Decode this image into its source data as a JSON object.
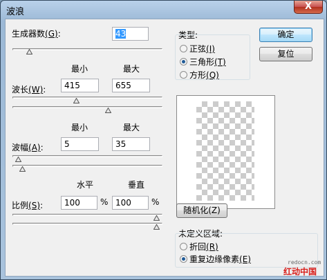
{
  "window": {
    "title": "波浪",
    "close_glyph": "X"
  },
  "generators": {
    "label": "生成器数",
    "hotkey": "(G)",
    "colon": ":",
    "value": "43",
    "slider_value_fraction": 0.08
  },
  "column_headers": {
    "min": "最小",
    "max": "最大",
    "horizontal": "水平",
    "vertical": "垂直"
  },
  "wavelength": {
    "label": "波长",
    "hotkey": "(W)",
    "colon": ":",
    "min": "415",
    "max": "655",
    "min_fraction": 0.42,
    "max_fraction": 0.65
  },
  "amplitude": {
    "label": "波幅",
    "hotkey": "(A)",
    "colon": ":",
    "min": "5",
    "max": "35",
    "min_fraction": 0.0,
    "max_fraction": 0.03
  },
  "scale": {
    "label": "比例",
    "hotkey": "(S)",
    "colon": ":",
    "horizontal": "100",
    "vertical": "100",
    "unit": "%",
    "h_fraction": 1.0,
    "v_fraction": 1.0
  },
  "type_group": {
    "title": "类型:",
    "options": [
      {
        "label": "正弦",
        "hotkey": "(I)",
        "selected": false
      },
      {
        "label": "三角形",
        "hotkey": "(T)",
        "selected": true
      },
      {
        "label": "方形",
        "hotkey": "(Q)",
        "selected": false
      }
    ]
  },
  "buttons": {
    "ok": "确定",
    "reset": "复位",
    "randomize": "随机化(Z)"
  },
  "undefined_area": {
    "title": "未定义区域:",
    "options": [
      {
        "label": "折回",
        "hotkey": "(R)",
        "selected": false
      },
      {
        "label": "重复边缘像素",
        "hotkey": "(E)",
        "selected": true
      }
    ]
  },
  "watermark": {
    "url": "redocn.com",
    "brand": "红动中国"
  },
  "colors": {
    "selection": "#3399ff",
    "accent_brand": "#d8201c"
  }
}
